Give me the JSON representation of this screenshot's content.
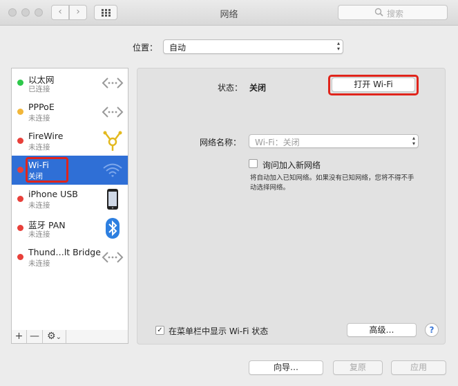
{
  "window": {
    "title": "网络",
    "search_placeholder": "搜索"
  },
  "location": {
    "label": "位置：",
    "value": "自动"
  },
  "services": [
    {
      "name": "以太网",
      "status": "已连接",
      "dot": "#2ec84a",
      "icon": "ethernet-icon"
    },
    {
      "name": "PPPoE",
      "status": "未连接",
      "dot": "#f2b73a",
      "icon": "ethernet-icon"
    },
    {
      "name": "FireWire",
      "status": "未连接",
      "dot": "#e8403a",
      "icon": "firewire-icon"
    },
    {
      "name": "Wi-Fi",
      "status": "关闭",
      "dot": "#e8403a",
      "icon": "wifi-icon",
      "selected": true
    },
    {
      "name": "iPhone USB",
      "status": "未连接",
      "dot": "#e8403a",
      "icon": "iphone-icon"
    },
    {
      "name": "蓝牙 PAN",
      "status": "未连接",
      "dot": "#e8403a",
      "icon": "bluetooth-icon"
    },
    {
      "name": "Thund…lt Bridge",
      "status": "未连接",
      "dot": "#e8403a",
      "icon": "ethernet-icon"
    }
  ],
  "sidebar_tools": {
    "add": "+",
    "remove": "—",
    "gear": "⚙",
    "chevron": "⌄"
  },
  "detail": {
    "status_label": "状态：",
    "status_value": "关闭",
    "toggle_button": "打开 Wi-Fi",
    "network_name_label": "网络名称：",
    "network_name_value": "Wi-Fi：关闭",
    "ask_join_label": "询问加入新网络",
    "ask_join_note": "将自动加入已知网络。如果没有已知网络，您将不得不手动选择网络。",
    "menubar_label": "在菜单栏中显示 Wi-Fi 状态",
    "menubar_checked": "✓",
    "advanced_button": "高级…",
    "help_button": "?"
  },
  "footer": {
    "assistant_button": "向导…",
    "revert_button": "复原",
    "apply_button": "应用"
  },
  "colors": {
    "selection": "#2f6fd6",
    "highlight_red": "#e0241b"
  }
}
